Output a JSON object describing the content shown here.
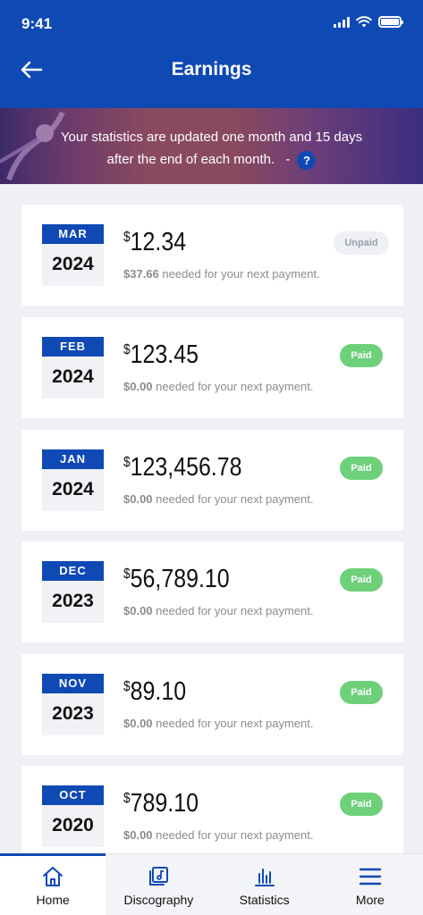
{
  "status_bar": {
    "time": "9:41"
  },
  "header": {
    "title": "Earnings"
  },
  "banner": {
    "text": "Your statistics are updated one month and 15 days after the end of each month.",
    "dash": "-",
    "help_label": "?"
  },
  "earnings": [
    {
      "month": "MAR",
      "year": "2024",
      "currency": "$",
      "amount": "12.34",
      "needed": "$37.66",
      "needed_suffix": " needed for your next payment.",
      "status": "Unpaid"
    },
    {
      "month": "FEB",
      "year": "2024",
      "currency": "$",
      "amount": "123.45",
      "needed": "$0.00",
      "needed_suffix": " needed for your next payment.",
      "status": "Paid"
    },
    {
      "month": "JAN",
      "year": "2024",
      "currency": "$",
      "amount": "123,456.78",
      "needed": "$0.00",
      "needed_suffix": " needed for your next payment.",
      "status": "Paid"
    },
    {
      "month": "DEC",
      "year": "2023",
      "currency": "$",
      "amount": "56,789.10",
      "needed": "$0.00",
      "needed_suffix": " needed for your next payment.",
      "status": "Paid"
    },
    {
      "month": "NOV",
      "year": "2023",
      "currency": "$",
      "amount": "89.10",
      "needed": "$0.00",
      "needed_suffix": " needed for your next payment.",
      "status": "Paid"
    },
    {
      "month": "OCT",
      "year": "2020",
      "currency": "$",
      "amount": "789.10",
      "needed": "$0.00",
      "needed_suffix": " needed for your next payment.",
      "status": "Paid"
    }
  ],
  "tabbar": {
    "items": [
      {
        "label": "Home",
        "icon": "home-icon",
        "active": true
      },
      {
        "label": "Discography",
        "icon": "discography-icon",
        "active": false
      },
      {
        "label": "Statistics",
        "icon": "statistics-icon",
        "active": false
      },
      {
        "label": "More",
        "icon": "menu-icon",
        "active": false
      }
    ]
  },
  "colors": {
    "brand": "#0f49b4",
    "paid": "#6fd07a",
    "unpaid_bg": "#eef0f5"
  }
}
